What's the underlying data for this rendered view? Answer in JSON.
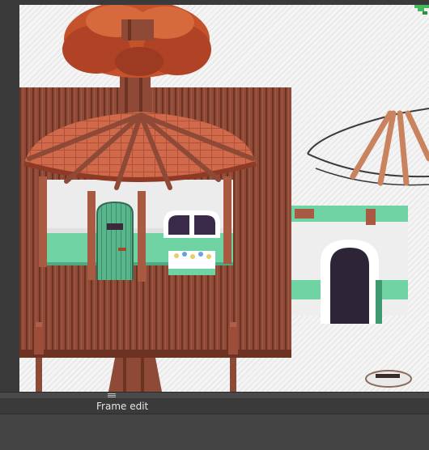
{
  "panel": {
    "title": "Frame edit"
  },
  "icons": {
    "divider_grip": "drag-handle-icon"
  },
  "colors": {
    "app_background": "#3a3a3a",
    "panel_body": "#444444",
    "panel_text": "#e6e6e6",
    "frame_fill": "#8e4a37",
    "roof": "#d06a4a",
    "tree_leaves": "#c4532c",
    "mint_band": "#6fd3a4"
  }
}
